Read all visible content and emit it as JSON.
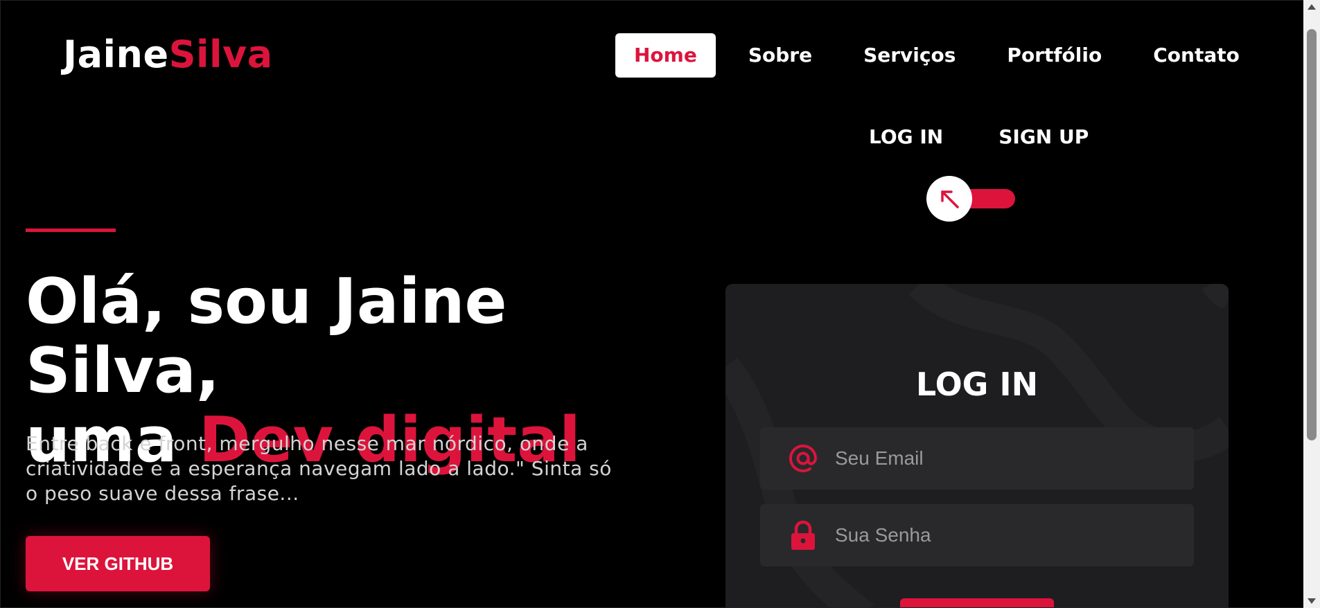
{
  "brand": {
    "first": "Jaine",
    "last": "Silva"
  },
  "nav": {
    "items": [
      {
        "label": "Home",
        "active": true
      },
      {
        "label": "Sobre",
        "active": false
      },
      {
        "label": "Serviços",
        "active": false
      },
      {
        "label": "Portfólio",
        "active": false
      },
      {
        "label": "Contato",
        "active": false
      }
    ]
  },
  "auth": {
    "login_label": "LOG IN",
    "signup_label": "SIGN UP",
    "toggle_icon": "arrow-up-left-icon"
  },
  "hero": {
    "title_line1": "Olá, sou Jaine Silva,",
    "title_line2_prefix": "uma ",
    "title_line2_accent": "Dev digital",
    "description": "Entre back e front, mergulho nesse mar nórdico, onde a criatividade e a esperança navegam lado a lado.\" Sinta só o peso suave dessa frase...",
    "cta_label": "VER GITHUB"
  },
  "login_card": {
    "title": "LOG IN",
    "email": {
      "placeholder": "Seu Email",
      "value": "",
      "icon": "at-icon"
    },
    "password": {
      "placeholder": "Sua Senha",
      "value": "",
      "icon": "lock-icon"
    }
  },
  "colors": {
    "accent": "#dc143c",
    "background": "#000000",
    "card": "#1e1e20",
    "field": "#29292c"
  }
}
